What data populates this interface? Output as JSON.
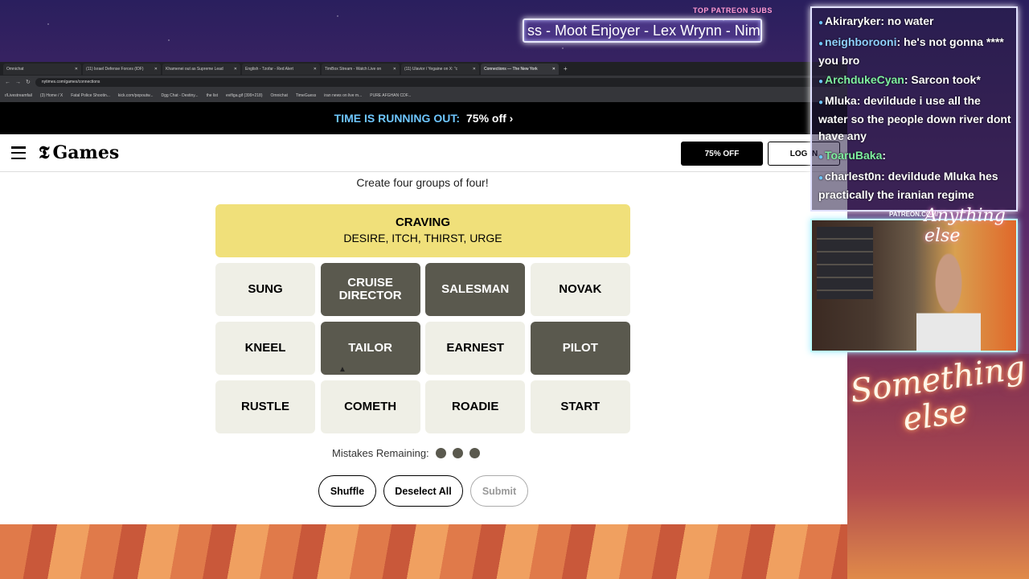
{
  "overlay": {
    "sub_label": "TOP PATREON SUBS",
    "sub_ticker": "ss - Moot Enjoyer - Lex Wrynn - Nimr",
    "patreon_label": "PATREON.COM/",
    "cam_sign": "Anything else",
    "neon_line1": "Something",
    "neon_line2": "else"
  },
  "browser": {
    "tabs": [
      {
        "label": "Omnichat"
      },
      {
        "label": "(11) Israel Defense Forces (IDF)"
      },
      {
        "label": "Khamenei out as Supreme Lead"
      },
      {
        "label": "English - Tzofar - Red Alert"
      },
      {
        "label": "TimBox Stream - Watch Live on"
      },
      {
        "label": "(11) Ulavior / Yegaine on X: \"c"
      },
      {
        "label": "Connections — The New York"
      }
    ],
    "url": "nytimes.com/games/connections",
    "bookmarks": [
      "r/Livestreamfail",
      "(3) Home / X",
      "Fatal Police Shootin...",
      "kick.com/popoutw...",
      "Dgg Chat - Destiny...",
      "the list",
      "evifiga.gif (399×218)",
      "Omnichat",
      "TimeGuess",
      "iran news on live m...",
      "PURE AFGHAN CDF..."
    ]
  },
  "promo": {
    "text": "TIME IS RUNNING OUT:",
    "offer": "75% off ›"
  },
  "header": {
    "logo": "Games",
    "offer_button": "75% OFF",
    "login_button": "LOG IN"
  },
  "game": {
    "instructions": "Create four groups of four!",
    "solved": [
      {
        "category": "CRAVING",
        "words": "DESIRE, ITCH, THIRST, URGE",
        "color": "#f0e07a"
      }
    ],
    "tiles": [
      {
        "word": "SUNG",
        "selected": false
      },
      {
        "word": "CRUISE DIRECTOR",
        "selected": true
      },
      {
        "word": "SALESMAN",
        "selected": true
      },
      {
        "word": "NOVAK",
        "selected": false
      },
      {
        "word": "KNEEL",
        "selected": false
      },
      {
        "word": "TAILOR",
        "selected": true
      },
      {
        "word": "EARNEST",
        "selected": false
      },
      {
        "word": "PILOT",
        "selected": true
      },
      {
        "word": "RUSTLE",
        "selected": false
      },
      {
        "word": "COMETH",
        "selected": false
      },
      {
        "word": "ROADIE",
        "selected": false
      },
      {
        "word": "START",
        "selected": false
      }
    ],
    "mistakes_label": "Mistakes Remaining:",
    "mistakes_remaining": 3,
    "buttons": {
      "shuffle": "Shuffle",
      "deselect": "Deselect All",
      "submit": "Submit"
    }
  },
  "chat": {
    "messages": [
      {
        "user": "Akiraryker",
        "user_color": "#ffffff",
        "text": "no water"
      },
      {
        "user": "neighborooni",
        "user_color": "#8fd0ff",
        "text": "he's not gonna **** you bro"
      },
      {
        "user": "ArchdukeCyan",
        "user_color": "#7ff0a0",
        "text": "Sarcon took*"
      },
      {
        "user": "Mluka",
        "user_color": "#ffffff",
        "text": "devildude i use all the water so the people down river dont have any"
      },
      {
        "user": "ToaruBaka",
        "user_color": "#7ff0a0",
        "text": ""
      },
      {
        "user": "charlest0n",
        "user_color": "#ffffff",
        "text": "devildude Mluka hes practically the iranian regime"
      }
    ]
  }
}
